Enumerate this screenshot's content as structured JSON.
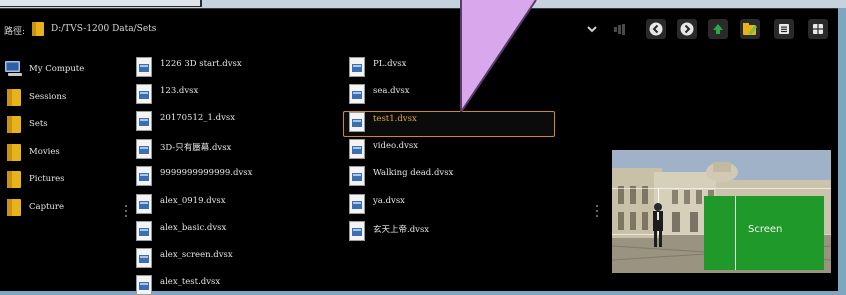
{
  "path_bar": {
    "label": "路徑:",
    "path": "D:/TVS-1200 Data/Sets"
  },
  "toolbar": {
    "icons": [
      "chevron-down-icon",
      "audio-icon",
      "back-icon",
      "forward-icon",
      "up-icon",
      "folder-edit-icon",
      "list-view-icon",
      "grid-view-icon"
    ],
    "accent": "#d08a24",
    "up_color": "#28a745"
  },
  "sidebar": {
    "items": [
      {
        "label": "My Compute",
        "icon": "computer-icon"
      },
      {
        "label": "Sessions",
        "icon": "folder-icon"
      },
      {
        "label": "Sets",
        "icon": "folder-icon"
      },
      {
        "label": "Movies",
        "icon": "folder-icon"
      },
      {
        "label": "Pictures",
        "icon": "folder-icon"
      },
      {
        "label": "Capture",
        "icon": "folder-icon"
      }
    ]
  },
  "files": {
    "col1": [
      "1226 3D start.dvsx",
      "123.dvsx",
      "20170512_1.dvsx",
      "3D-只有蜃幕.dvsx",
      "9999999999999.dvsx",
      "alex_0919.dvsx",
      "alex_basic.dvsx",
      "alex_screen.dvsx",
      "alex_test.dvsx"
    ],
    "col2": [
      "PL.dvsx",
      "sea.dvsx",
      "test1.dvsx",
      "video.dvsx",
      "Walking dead.dvsx",
      "ya.dvsx",
      "玄天上帝.dvsx"
    ],
    "selected": "test1.dvsx"
  },
  "preview": {
    "screen_label": "Screen",
    "screen_color": "#1f9a2a"
  }
}
